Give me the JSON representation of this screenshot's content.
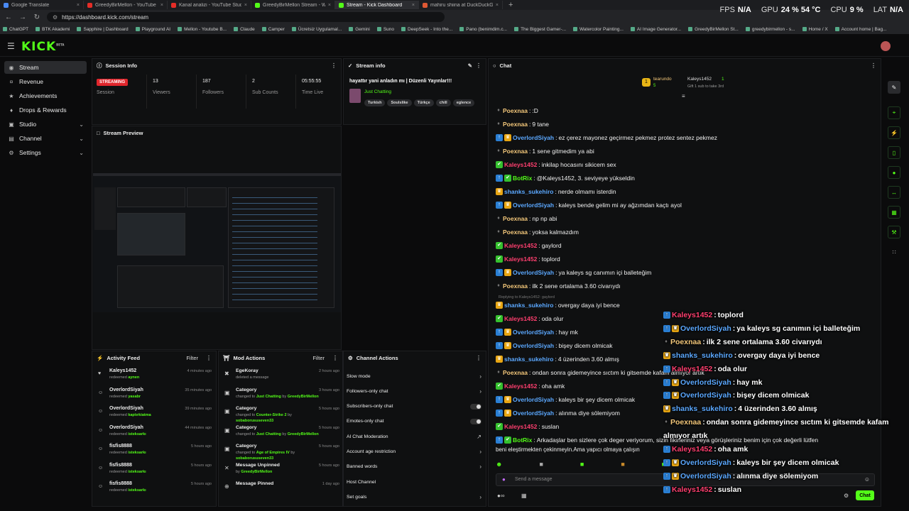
{
  "browser": {
    "tabs": [
      {
        "label": "Google Translate",
        "color": "#4a8af4"
      },
      {
        "label": "GreedyBirMellon - YouTube",
        "color": "#e52d27"
      },
      {
        "label": "Kanal analizi - YouTube Studio",
        "color": "#e52d27"
      },
      {
        "label": "GreedyBirMellon Stream - Watch",
        "color": "#53fc18"
      },
      {
        "label": "Stream - Kick Dashboard",
        "color": "#53fc18"
      },
      {
        "label": "mahiru shiina at DuckDuckGo",
        "color": "#de5833"
      }
    ],
    "url": "https://dashboard.kick.com/stream",
    "bookmarks": [
      "ChatGPT",
      "BTK Akademi",
      "Sapphire | Dashboard",
      "Playground AI",
      "Mellon - Youtube B...",
      "Claude",
      "Camper",
      "Ücretsiz Uygulamal...",
      "Gemini",
      "Suno",
      "DeepSeek - Into the...",
      "Pano (benimdim.c...",
      "The Biggest Gamer-...",
      "Watercolor Painting...",
      "AI Image Generator...",
      "GreedyBirMellon St...",
      "greedybirmellon - s...",
      "Home / X",
      "Account home | Bag..."
    ]
  },
  "hud": {
    "fps_label": "FPS",
    "fps": "N/A",
    "gpu_label": "GPU",
    "gpu": "24 % 54 °C",
    "cpu_label": "CPU",
    "cpu": "9 %",
    "lat_label": "LAT",
    "lat": "N/A"
  },
  "logo": "KICK",
  "logo_sup": "BETA",
  "sidebar": {
    "items": [
      {
        "label": "Stream",
        "icon": "stream-icon"
      },
      {
        "label": "Revenue",
        "icon": "revenue-icon"
      },
      {
        "label": "Achievements",
        "icon": "achievements-icon"
      },
      {
        "label": "Drops & Rewards",
        "icon": "drops-icon"
      },
      {
        "label": "Studio",
        "icon": "studio-icon"
      },
      {
        "label": "Channel",
        "icon": "channel-icon"
      },
      {
        "label": "Settings",
        "icon": "settings-icon"
      }
    ]
  },
  "session": {
    "title": "Session Info",
    "badge": "STREAMING",
    "stats": [
      {
        "value": "",
        "label": "Session"
      },
      {
        "value": "13",
        "label": "Viewers"
      },
      {
        "value": "187",
        "label": "Followers"
      },
      {
        "value": "2",
        "label": "Sub Counts"
      },
      {
        "value": "05:55:55",
        "label": "Time Live"
      }
    ]
  },
  "streaminfo": {
    "title": "Stream info",
    "stream_title": "hayattır yani anladın mı | Düzenli Yayınlar!!!",
    "category": "Just Chatting",
    "tags": [
      "Turkish",
      "Soulslike",
      "Türkçe",
      "chill",
      "eglence"
    ]
  },
  "preview": {
    "title": "Stream Preview"
  },
  "activity": {
    "title": "Activity Feed",
    "filter": "Filter",
    "items": [
      {
        "name": "Kaleys1452",
        "verb": "redeemed",
        "reward": "aynen",
        "time": "4 minutes ago"
      },
      {
        "name": "OverlordSiyah",
        "verb": "redeemed",
        "reward": "yasabr",
        "time": "35 minutes ago"
      },
      {
        "name": "OverlordSiyah",
        "verb": "redeemed",
        "reward": "kaptırkiatma",
        "time": "39 minutes ago"
      },
      {
        "name": "OverlordSiyah",
        "verb": "redeemed",
        "reward": "isteksarkı",
        "time": "44 minutes ago"
      },
      {
        "name": "fisfis8888",
        "verb": "redeemed",
        "reward": "isteksarkı",
        "time": "5 hours ago"
      },
      {
        "name": "fisfis8888",
        "verb": "redeemed",
        "reward": "isteksarkı",
        "time": "5 hours ago"
      },
      {
        "name": "fisfis8888",
        "verb": "redeemed",
        "reward": "isteksarkı",
        "time": "5 hours ago"
      }
    ]
  },
  "modactions": {
    "title": "Mod Actions",
    "filter": "Filter",
    "items": [
      {
        "name": "EgeKoray",
        "l1": "deleted a message",
        "hl": "",
        "l2": "",
        "hl2": "",
        "time": "2 hours ago"
      },
      {
        "name": "Category",
        "l1": "changed to",
        "hl": "Just Chatting",
        "l2": "by",
        "hl2": "GreedyBirMellon",
        "time": "3 hours ago"
      },
      {
        "name": "Category",
        "l1": "changed to",
        "hl": "Counter-Strike 2",
        "l2": "by",
        "hl2": "sobaborususeven33",
        "time": "5 hours ago"
      },
      {
        "name": "Category",
        "l1": "changed to",
        "hl": "Just Chatting",
        "l2": "by",
        "hl2": "GreedyBirMellon",
        "time": "5 hours ago"
      },
      {
        "name": "Category",
        "l1": "changed to",
        "hl": "Age of Empires IV",
        "l2": "by",
        "hl2": "sobaborususeven33",
        "time": "5 hours ago"
      },
      {
        "name": "Message Unpinned",
        "l1": "by",
        "hl": "GreedyBirMellon",
        "l2": "",
        "hl2": "",
        "time": "5 hours ago"
      },
      {
        "name": "Message Pinned",
        "l1": "",
        "hl": "",
        "l2": "",
        "hl2": "",
        "time": "1 day ago"
      }
    ]
  },
  "channelactions": {
    "title": "Channel Actions",
    "items": [
      {
        "label": "Slow mode",
        "kind": "arrow"
      },
      {
        "label": "Followers-only chat",
        "kind": "arrow"
      },
      {
        "label": "Subscribers-only chat",
        "kind": "toggle"
      },
      {
        "label": "Emotes-only chat",
        "kind": "toggle"
      },
      {
        "label": "AI Chat Moderation",
        "kind": "ext"
      },
      {
        "label": "Account age restriction",
        "kind": "arrow"
      },
      {
        "label": "Banned words",
        "kind": "arrow"
      },
      {
        "label": "Host Channel",
        "kind": "none"
      },
      {
        "label": "Set goals",
        "kind": "arrow"
      }
    ]
  },
  "chat": {
    "title": "Chat",
    "gifter": {
      "name": "tearundo",
      "count": "5",
      "recipient": "Kaleys1452",
      "rcount": "1",
      "note": "Gift 1 sub to take 3rd"
    },
    "reply_note": "Replying to Kaleys1452: gaylord",
    "input_placeholder": "Send a message",
    "send": "Chat",
    "messages": [
      {
        "badges": [
          "plain"
        ],
        "name": "Poexnaa",
        "color": "#f3c77a",
        "text": ":D"
      },
      {
        "badges": [
          "plain"
        ],
        "name": "Poexnaa",
        "color": "#f3c77a",
        "text": "9 tane"
      },
      {
        "badges": [
          "blue",
          "gold"
        ],
        "name": "OverlordSiyah",
        "color": "#5ba8ff",
        "text": "ez çerez mayonez geçirmez pekmez protez sentez pekmez"
      },
      {
        "badges": [
          "plain"
        ],
        "name": "Poexnaa",
        "color": "#f3c77a",
        "text": "1 sene gitmedim ya abi"
      },
      {
        "badges": [
          "green"
        ],
        "name": "Kaleys1452",
        "color": "#ff3f6f",
        "text": "inkilap hocasını sikicem sex"
      },
      {
        "badges": [
          "blue",
          "green"
        ],
        "name": "BotRix",
        "color": "#53fc18",
        "text": "@Kaleys1452, 3. seviyeye yükseldin"
      },
      {
        "badges": [
          "gold"
        ],
        "name": "shanks_sukehiro",
        "color": "#5ba8ff",
        "text": "nerde olmamı isterdin"
      },
      {
        "badges": [
          "blue",
          "gold"
        ],
        "name": "OverlordSiyah",
        "color": "#5ba8ff",
        "text": "kaleys bende gelim mi ay ağzımdan kaçtı ayol"
      },
      {
        "badges": [
          "plain"
        ],
        "name": "Poexnaa",
        "color": "#f3c77a",
        "text": "np np abi"
      },
      {
        "badges": [
          "plain"
        ],
        "name": "Poexnaa",
        "color": "#f3c77a",
        "text": "yoksa kalmazdım"
      },
      {
        "badges": [
          "green"
        ],
        "name": "Kaleys1452",
        "color": "#ff3f6f",
        "text": "gaylord"
      },
      {
        "badges": [
          "green"
        ],
        "name": "Kaleys1452",
        "color": "#ff3f6f",
        "text": "toplord"
      },
      {
        "badges": [
          "blue",
          "gold"
        ],
        "name": "OverlordSiyah",
        "color": "#5ba8ff",
        "text": "ya kaleys sg canımın içi balleteğim"
      },
      {
        "badges": [
          "plain"
        ],
        "name": "Poexnaa",
        "color": "#f3c77a",
        "text": "ilk 2 sene ortalama 3.60 civarıydı"
      },
      {
        "badges": [
          "gold"
        ],
        "name": "shanks_sukehiro",
        "color": "#5ba8ff",
        "text": "overgay daya iyi bence"
      },
      {
        "badges": [
          "green"
        ],
        "name": "Kaleys1452",
        "color": "#ff3f6f",
        "text": "oda olur"
      },
      {
        "badges": [
          "blue",
          "gold"
        ],
        "name": "OverlordSiyah",
        "color": "#5ba8ff",
        "text": "hay mk"
      },
      {
        "badges": [
          "blue",
          "gold"
        ],
        "name": "OverlordSiyah",
        "color": "#5ba8ff",
        "text": "bişey dicem olmicak"
      },
      {
        "badges": [
          "gold"
        ],
        "name": "shanks_sukehiro",
        "color": "#5ba8ff",
        "text": "4 üzerinden 3.60 almış"
      },
      {
        "badges": [
          "plain"
        ],
        "name": "Poexnaa",
        "color": "#f3c77a",
        "text": "ondan sonra gidemeyince sıctım ki gitsemde kafam almıyor artık"
      },
      {
        "badges": [
          "green"
        ],
        "name": "Kaleys1452",
        "color": "#ff3f6f",
        "text": "oha amk"
      },
      {
        "badges": [
          "blue",
          "gold"
        ],
        "name": "OverlordSiyah",
        "color": "#5ba8ff",
        "text": "kaleys bir şey dicem olmicak"
      },
      {
        "badges": [
          "blue",
          "gold"
        ],
        "name": "OverlordSiyah",
        "color": "#5ba8ff",
        "text": "alınma diye sölemiyom"
      },
      {
        "badges": [
          "green"
        ],
        "name": "Kaleys1452",
        "color": "#ff3f6f",
        "text": "suslan"
      },
      {
        "badges": [
          "blue",
          "green"
        ],
        "name": "BotRix",
        "color": "#53fc18",
        "text": "Arkadaşlar ben sizlere çok deger veriyorum, sizin fikirleriniz veya görüşleriniz benim için çok değerli lütfen"
      }
    ],
    "botrix_line2": "beni eleştirmekten çekinmeyin.Ama yapıcı olmaya çalışın"
  },
  "overlay": {
    "messages": [
      {
        "badges": [
          "blue"
        ],
        "name": "Kaleys1452",
        "color": "#ff3f6f",
        "text": "toplord"
      },
      {
        "badges": [
          "blue",
          "gold"
        ],
        "name": "OverlordSiyah",
        "color": "#5ba8ff",
        "text": "ya kaleys sg canımın içi balleteğim"
      },
      {
        "badges": [
          "plain"
        ],
        "name": "Poexnaa",
        "color": "#f3c77a",
        "text": "ilk 2 sene ortalama 3.60 civarıydı"
      },
      {
        "badges": [
          "gold"
        ],
        "name": "shanks_sukehiro",
        "color": "#5ba8ff",
        "text": "overgay daya iyi bence"
      },
      {
        "badges": [
          "blue"
        ],
        "name": "Kaleys1452",
        "color": "#ff3f6f",
        "text": "oda olur"
      },
      {
        "badges": [
          "blue",
          "gold"
        ],
        "name": "OverlordSiyah",
        "color": "#5ba8ff",
        "text": "hay mk"
      },
      {
        "badges": [
          "blue",
          "gold"
        ],
        "name": "OverlordSiyah",
        "color": "#5ba8ff",
        "text": "bişey dicem olmicak"
      },
      {
        "badges": [
          "gold"
        ],
        "name": "shanks_sukehiro",
        "color": "#5ba8ff",
        "text": "4 üzerinden 3.60 almış"
      },
      {
        "badges": [
          "plain"
        ],
        "name": "Poexnaa",
        "color": "#f3c77a",
        "text": "ondan sonra gidemeyince sıctım ki gitsemde kafam"
      },
      {
        "badges": [],
        "name": "",
        "color": "#ffffff",
        "text": "almıyor artık"
      },
      {
        "badges": [
          "blue"
        ],
        "name": "Kaleys1452",
        "color": "#ff3f6f",
        "text": "oha amk"
      },
      {
        "badges": [
          "blue",
          "gold"
        ],
        "name": "OverlordSiyah",
        "color": "#5ba8ff",
        "text": "kaleys bir şey dicem olmicak"
      },
      {
        "badges": [
          "blue",
          "gold"
        ],
        "name": "OverlordSiyah",
        "color": "#5ba8ff",
        "text": "alınma diye sölemiyom"
      },
      {
        "badges": [
          "blue"
        ],
        "name": "Kaleys1452",
        "color": "#ff3f6f",
        "text": "suslan"
      }
    ]
  }
}
